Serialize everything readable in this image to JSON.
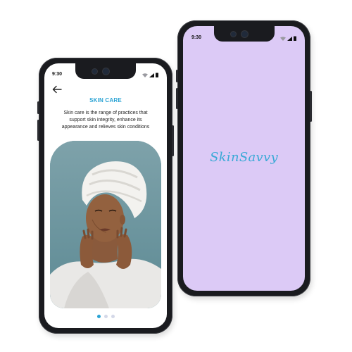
{
  "splash_screen": {
    "status_time": "9:30",
    "brand": "SkinSavvy",
    "background_color": "#dccaf6",
    "brand_color": "#3aa9d6"
  },
  "onboarding_screen": {
    "status_time": "9:30",
    "back_icon": "arrow-left-icon",
    "title": "SKIN CARE",
    "description": "Skin care is the range of practices that support skin integrity, enhance its appearance and relieves skin conditions",
    "photo_alt": "woman-with-towel-wrap",
    "pager": {
      "total": 3,
      "active": 1
    },
    "accent_color": "#2aa3d4"
  }
}
